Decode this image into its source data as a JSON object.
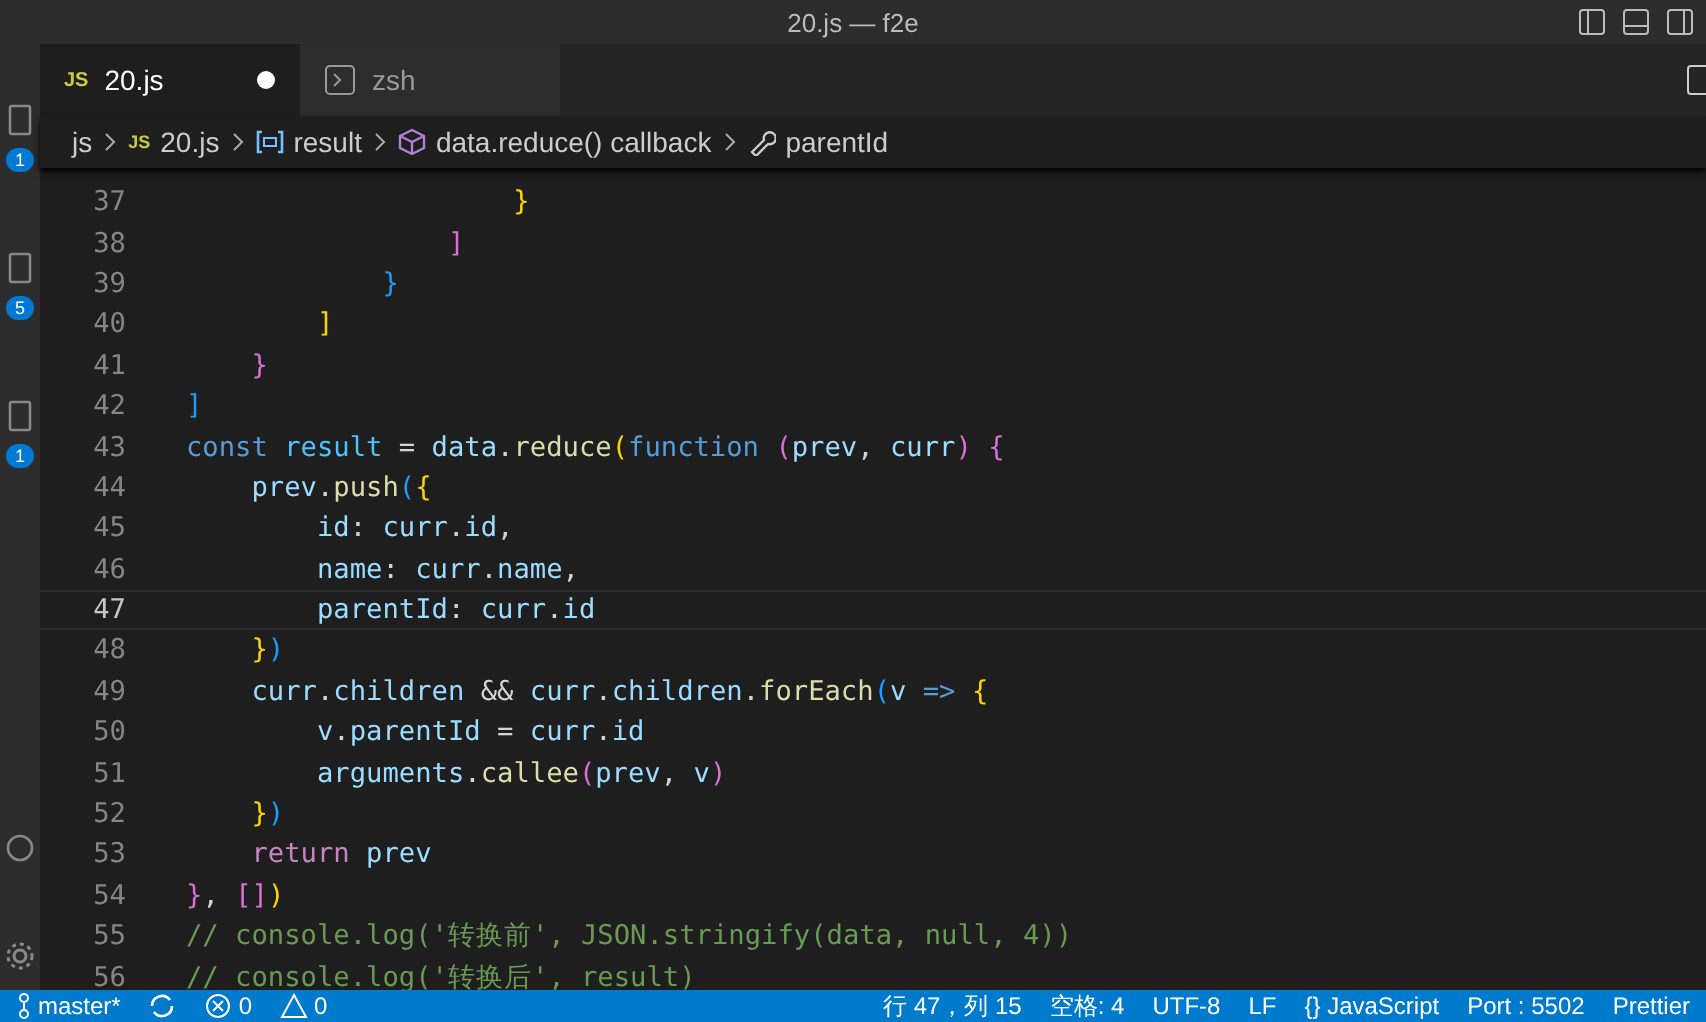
{
  "window": {
    "title": "20.js — f2e"
  },
  "activity_bar": {
    "badges": [
      "1",
      "5",
      "1"
    ]
  },
  "tabs": [
    {
      "label": "20.js",
      "kind": "file",
      "icon_text": "JS",
      "selected": true,
      "dirty": true
    },
    {
      "label": "zsh",
      "kind": "terminal",
      "selected": false,
      "dirty": false
    }
  ],
  "breadcrumbs": [
    {
      "label": "js",
      "kind": "folder"
    },
    {
      "label": "20.js",
      "kind": "file",
      "icon_text": "JS"
    },
    {
      "label": "result",
      "kind": "variable"
    },
    {
      "label": "data.reduce() callback",
      "kind": "method"
    },
    {
      "label": "parentId",
      "kind": "property"
    }
  ],
  "editor": {
    "lines": [
      {
        "number": "37",
        "current": false,
        "tokens": [
          {
            "kind": "bracket1",
            "text": "                    }"
          }
        ]
      },
      {
        "number": "38",
        "current": false,
        "tokens": [
          {
            "kind": "bracket2",
            "text": "                ]"
          }
        ]
      },
      {
        "number": "39",
        "current": false,
        "tokens": [
          {
            "kind": "bracket3",
            "text": "            }"
          }
        ]
      },
      {
        "number": "40",
        "current": false,
        "tokens": [
          {
            "kind": "bracket1",
            "text": "        ]"
          }
        ]
      },
      {
        "number": "41",
        "current": false,
        "tokens": [
          {
            "kind": "bracket2",
            "text": "    }"
          }
        ]
      },
      {
        "number": "42",
        "current": false,
        "tokens": [
          {
            "kind": "bracket3",
            "text": "]"
          }
        ]
      },
      {
        "number": "43",
        "current": false,
        "tokens": [
          {
            "kind": "keyword",
            "text": "const "
          },
          {
            "kind": "constant",
            "text": "result"
          },
          {
            "kind": "punctuation",
            "text": " = "
          },
          {
            "kind": "variable",
            "text": "data"
          },
          {
            "kind": "punctuation",
            "text": "."
          },
          {
            "kind": "function",
            "text": "reduce"
          },
          {
            "kind": "bracket1",
            "text": "("
          },
          {
            "kind": "keyword",
            "text": "function "
          },
          {
            "kind": "bracket2",
            "text": "("
          },
          {
            "kind": "variable",
            "text": "prev"
          },
          {
            "kind": "punctuation",
            "text": ", "
          },
          {
            "kind": "variable",
            "text": "curr"
          },
          {
            "kind": "bracket2",
            "text": ") {"
          }
        ]
      },
      {
        "number": "44",
        "current": false,
        "tokens": [
          {
            "kind": "variable",
            "text": "    prev"
          },
          {
            "kind": "punctuation",
            "text": "."
          },
          {
            "kind": "function",
            "text": "push"
          },
          {
            "kind": "bracket3",
            "text": "("
          },
          {
            "kind": "bracket1",
            "text": "{"
          }
        ]
      },
      {
        "number": "45",
        "current": false,
        "tokens": [
          {
            "kind": "variable",
            "text": "        id"
          },
          {
            "kind": "punctuation",
            "text": ": "
          },
          {
            "kind": "variable",
            "text": "curr"
          },
          {
            "kind": "punctuation",
            "text": "."
          },
          {
            "kind": "variable",
            "text": "id"
          },
          {
            "kind": "punctuation",
            "text": ","
          }
        ]
      },
      {
        "number": "46",
        "current": false,
        "tokens": [
          {
            "kind": "variable",
            "text": "        name"
          },
          {
            "kind": "punctuation",
            "text": ": "
          },
          {
            "kind": "variable",
            "text": "curr"
          },
          {
            "kind": "punctuation",
            "text": "."
          },
          {
            "kind": "variable",
            "text": "name"
          },
          {
            "kind": "punctuation",
            "text": ","
          }
        ]
      },
      {
        "number": "47",
        "current": true,
        "tokens": [
          {
            "kind": "variable",
            "text": "        parentId"
          },
          {
            "kind": "punctuation",
            "text": ": "
          },
          {
            "kind": "variable",
            "text": "curr"
          },
          {
            "kind": "punctuation",
            "text": "."
          },
          {
            "kind": "variable",
            "text": "id"
          }
        ]
      },
      {
        "number": "48",
        "current": false,
        "tokens": [
          {
            "kind": "bracket1",
            "text": "    }"
          },
          {
            "kind": "bracket3",
            "text": ")"
          }
        ]
      },
      {
        "number": "49",
        "current": false,
        "tokens": [
          {
            "kind": "variable",
            "text": "    curr"
          },
          {
            "kind": "punctuation",
            "text": "."
          },
          {
            "kind": "variable",
            "text": "children"
          },
          {
            "kind": "punctuation",
            "text": " && "
          },
          {
            "kind": "variable",
            "text": "curr"
          },
          {
            "kind": "punctuation",
            "text": "."
          },
          {
            "kind": "variable",
            "text": "children"
          },
          {
            "kind": "punctuation",
            "text": "."
          },
          {
            "kind": "function",
            "text": "forEach"
          },
          {
            "kind": "bracket3",
            "text": "("
          },
          {
            "kind": "variable",
            "text": "v"
          },
          {
            "kind": "keyword",
            "text": " => "
          },
          {
            "kind": "bracket1",
            "text": "{"
          }
        ]
      },
      {
        "number": "50",
        "current": false,
        "tokens": [
          {
            "kind": "variable",
            "text": "        v"
          },
          {
            "kind": "punctuation",
            "text": "."
          },
          {
            "kind": "variable",
            "text": "parentId"
          },
          {
            "kind": "punctuation",
            "text": " = "
          },
          {
            "kind": "variable",
            "text": "curr"
          },
          {
            "kind": "punctuation",
            "text": "."
          },
          {
            "kind": "variable",
            "text": "id"
          }
        ]
      },
      {
        "number": "51",
        "current": false,
        "tokens": [
          {
            "kind": "variable",
            "text": "        arguments"
          },
          {
            "kind": "punctuation",
            "text": "."
          },
          {
            "kind": "function",
            "text": "callee"
          },
          {
            "kind": "bracket2",
            "text": "("
          },
          {
            "kind": "variable",
            "text": "prev"
          },
          {
            "kind": "punctuation",
            "text": ", "
          },
          {
            "kind": "variable",
            "text": "v"
          },
          {
            "kind": "bracket2",
            "text": ")"
          }
        ]
      },
      {
        "number": "52",
        "current": false,
        "tokens": [
          {
            "kind": "bracket1",
            "text": "    }"
          },
          {
            "kind": "bracket3",
            "text": ")"
          }
        ]
      },
      {
        "number": "53",
        "current": false,
        "tokens": [
          {
            "kind": "control",
            "text": "    return "
          },
          {
            "kind": "variable",
            "text": "prev"
          }
        ]
      },
      {
        "number": "54",
        "current": false,
        "tokens": [
          {
            "kind": "bracket2",
            "text": "}"
          },
          {
            "kind": "punctuation",
            "text": ", "
          },
          {
            "kind": "bracket2",
            "text": "[]"
          },
          {
            "kind": "bracket1",
            "text": ")"
          }
        ]
      },
      {
        "number": "55",
        "current": false,
        "tokens": [
          {
            "kind": "comment",
            "text": "// console.log('转换前', JSON.stringify(data, null, 4))"
          }
        ]
      },
      {
        "number": "56",
        "current": false,
        "tokens": [
          {
            "kind": "comment",
            "text": "// console.log('转换后', result)"
          }
        ]
      }
    ]
  },
  "status_bar": {
    "left": [
      {
        "kind": "branch",
        "label": "master*"
      },
      {
        "kind": "sync"
      },
      {
        "kind": "errors",
        "label": "0"
      },
      {
        "kind": "warnings",
        "label": "0"
      }
    ],
    "right": [
      "行 47，列 15",
      "空格: 4",
      "UTF-8",
      "LF",
      "{} JavaScript",
      "Port : 5502",
      "Prettier"
    ]
  }
}
